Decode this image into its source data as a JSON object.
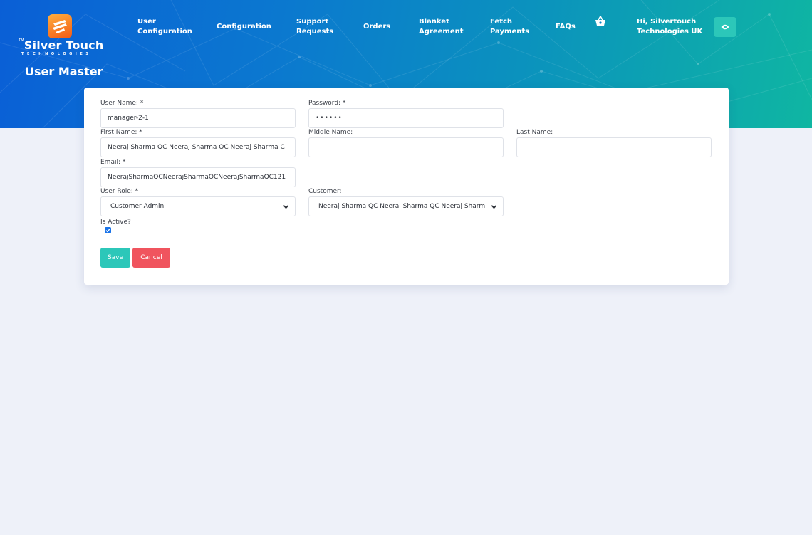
{
  "brand": {
    "name": "Silver Touch",
    "tm": "TM",
    "sub": "TECHNOLOGIES"
  },
  "nav": {
    "items": [
      {
        "line1": "User",
        "line2": "Configuration"
      },
      {
        "line1": "Configuration",
        "line2": ""
      },
      {
        "line1": "Support",
        "line2": "Requests"
      },
      {
        "line1": "Orders",
        "line2": ""
      },
      {
        "line1": "Blanket",
        "line2": "Agreement"
      },
      {
        "line1": "Fetch",
        "line2": "Payments"
      },
      {
        "line1": "FAQs",
        "line2": ""
      }
    ],
    "basket_icon": "shopping-basket-icon",
    "greeting_line1": "Hi, Silvertouch",
    "greeting_line2": "Technologies UK",
    "eye_icon": "eye-icon"
  },
  "page": {
    "title": "User Master"
  },
  "form": {
    "user_name": {
      "label": "User Name: *",
      "value": "manager-2-1"
    },
    "password": {
      "label": "Password: *",
      "value": "••••••"
    },
    "first_name": {
      "label": "First Name: *",
      "value": "Neeraj Sharma QC Neeraj Sharma QC Neeraj Sharma C"
    },
    "middle_name": {
      "label": "Middle Name:",
      "value": ""
    },
    "last_name": {
      "label": "Last Name:",
      "value": ""
    },
    "email": {
      "label": "Email: *",
      "value": "NeerajSharmaQCNeerajSharmaQCNeerajSharmaQC121"
    },
    "user_role": {
      "label": "User Role: *",
      "value": "Customer Admin"
    },
    "customer": {
      "label": "Customer:",
      "value": "Neeraj Sharma QC Neeraj Sharma QC Neeraj Sharm"
    },
    "is_active": {
      "label": "Is Active?",
      "checked": true
    },
    "save_label": "Save",
    "cancel_label": "Cancel"
  },
  "colors": {
    "accent_teal": "#2cc7b9",
    "cancel_red": "#f0545e",
    "checkbox_blue": "#1a73e8",
    "page_bg": "#eef1f9"
  }
}
